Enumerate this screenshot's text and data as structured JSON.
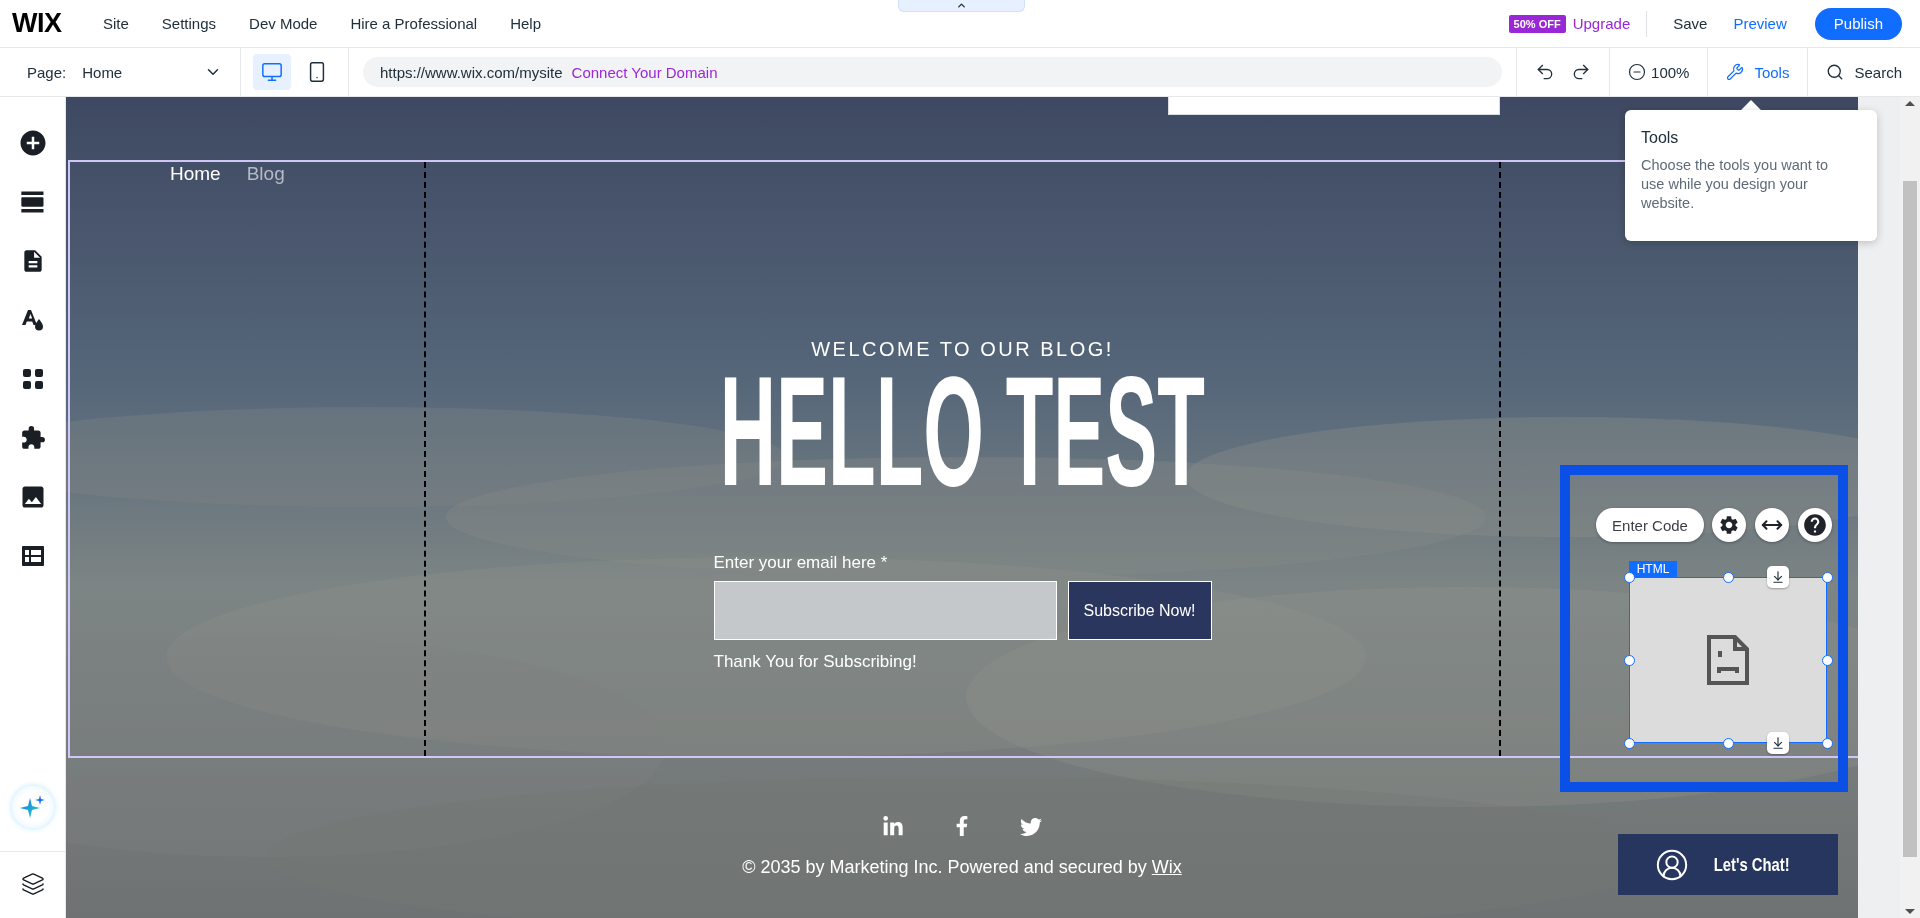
{
  "top_bar": {
    "logo": "WIX",
    "menu": [
      "Site",
      "Settings",
      "Dev Mode",
      "Hire a Professional",
      "Help"
    ],
    "promo_badge": "50% OFF",
    "upgrade": "Upgrade",
    "save": "Save",
    "preview": "Preview",
    "publish": "Publish"
  },
  "toolbar": {
    "page_label": "Page:",
    "page": "Home",
    "devices": [
      {
        "kind": "desktop",
        "selected": true
      },
      {
        "kind": "mobile",
        "selected": false
      }
    ],
    "url": "https://www.wix.com/mysite",
    "connect_domain": "Connect Your Domain",
    "zoom": "100%",
    "tools": {
      "label": "Tools",
      "selected": true
    },
    "search": "Search"
  },
  "sidebar": {
    "items": [
      {
        "kind": "add"
      },
      {
        "kind": "sections"
      },
      {
        "kind": "pages"
      },
      {
        "kind": "design"
      },
      {
        "kind": "apps"
      },
      {
        "kind": "business"
      },
      {
        "kind": "media"
      },
      {
        "kind": "cms"
      }
    ]
  },
  "site": {
    "nav": [
      {
        "label": "Home",
        "selected": true
      },
      {
        "label": "Blog",
        "selected": false
      }
    ],
    "kicker": "WELCOME TO OUR BLOG!",
    "headline": "HELLO TEST",
    "email_label": "Enter your email here *",
    "subscribe_button": "Subscribe Now!",
    "thank_you": "Thank You for Subscribing!",
    "social": [
      {
        "kind": "linkedin"
      },
      {
        "kind": "facebook"
      },
      {
        "kind": "twitter"
      }
    ],
    "copyright": "© 2035 by Marketing Inc. Powered and secured by",
    "copyright_link": "Wix",
    "chat_button": "Let's Chat!"
  },
  "tooltip": {
    "title": "Tools",
    "text": "Choose the tools you want to use while you design your website."
  },
  "html_widget": {
    "tag": "HTML",
    "enter_code": "Enter Code",
    "selected": true
  }
}
